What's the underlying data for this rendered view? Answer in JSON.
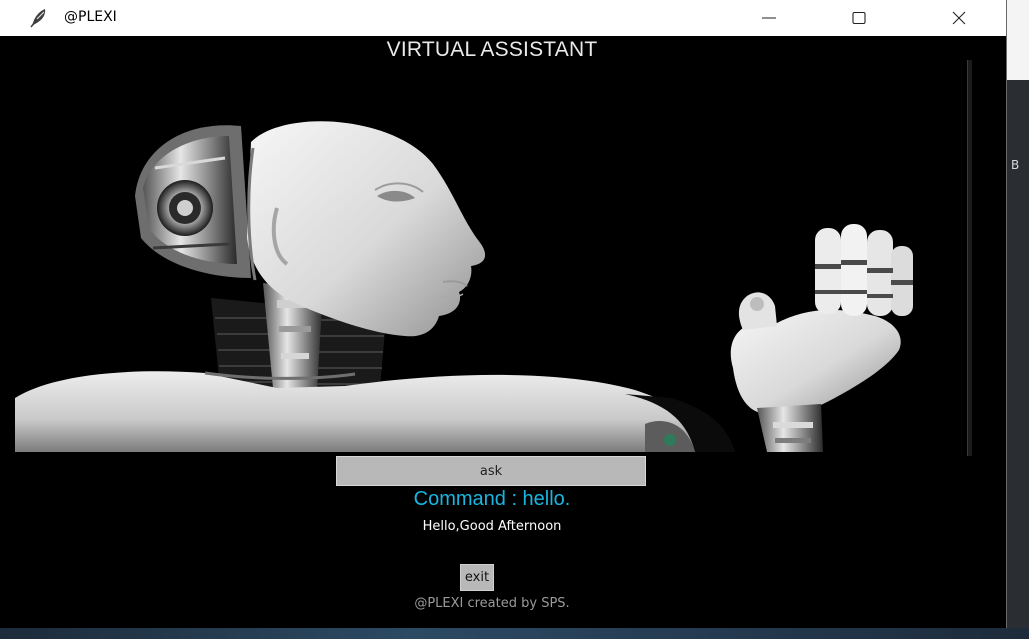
{
  "window": {
    "title": "@PLEXI",
    "icon": "feather-icon",
    "controls": [
      "minimize-icon",
      "maximize-icon",
      "close-icon"
    ]
  },
  "app": {
    "heading": "VIRTUAL ASSISTANT",
    "image": "robot-image",
    "ask_label": "ask",
    "command_text": "Command : hello.",
    "response_text": "Hello,Good Afternoon",
    "exit_label": "exit",
    "credit_text": "@PLEXI created by SPS."
  },
  "desktop": {
    "edge_glyph": "B"
  },
  "colors": {
    "background": "#000000",
    "command": "#18b6e2",
    "button": "#b8b8b8",
    "credit": "#9a9a9a"
  }
}
